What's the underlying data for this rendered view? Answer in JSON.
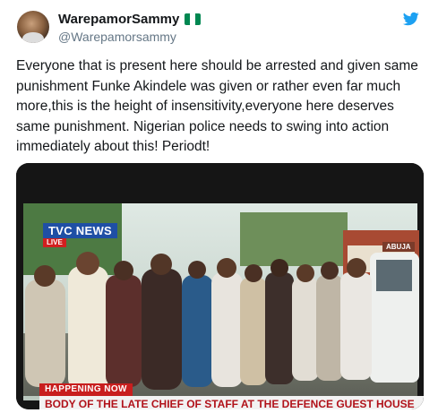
{
  "tweet": {
    "display_name": "WarepamorSammy",
    "handle": "@Warepamorsammy",
    "text": "Everyone that is present here should be arrested and given same punishment Funke Akindele was given or rather even far much more,this is the height of insensitivity,everyone here deserves same punishment. Nigerian police needs to swing into action immediately about this! Periodt!"
  },
  "icons": {
    "flag": "nigeria-flag-icon",
    "bird": "twitter-bird-icon"
  },
  "colors": {
    "twitter_blue": "#1da1f2",
    "flag_green": "#008751",
    "name_text": "#14171a",
    "handle_text": "#657786"
  },
  "media": {
    "channel_logo": "TVC NEWS",
    "live_badge": "LIVE",
    "location_sign": "ABUJA",
    "happening_now": "HAPPENING NOW",
    "headline": "BODY OF THE LATE CHIEF OF STAFF AT THE DEFENCE GUEST HOUSE"
  }
}
